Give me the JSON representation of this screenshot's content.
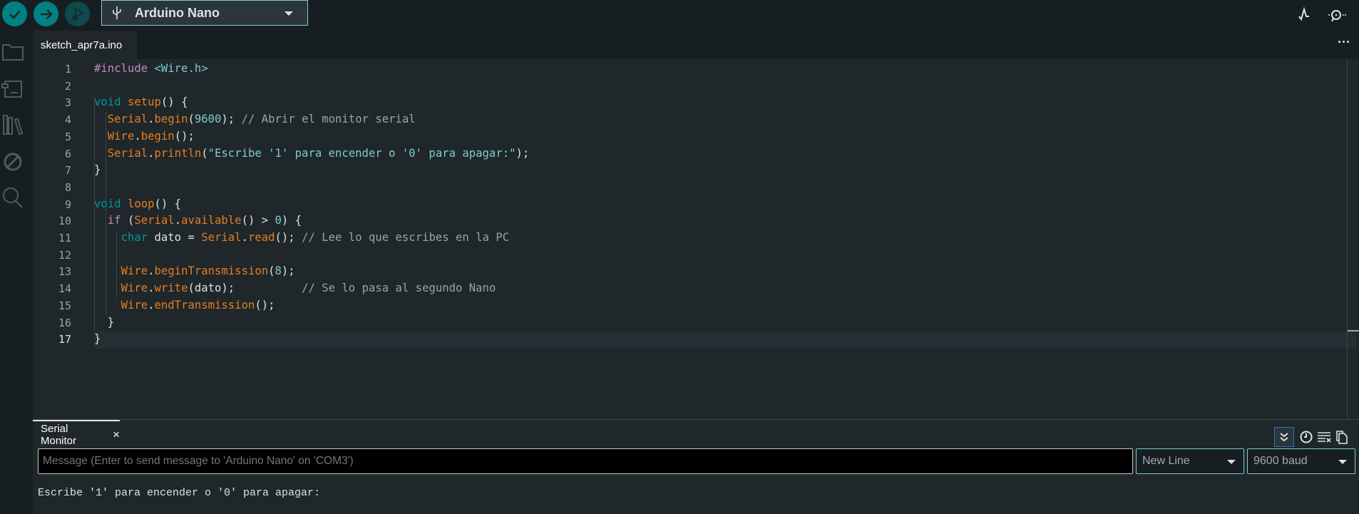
{
  "toolbar": {
    "verify": "check-icon",
    "upload": "arrow-right-icon",
    "debug": "debug-icon",
    "board": "Arduino Nano",
    "serial_plotter": "plotter-icon",
    "serial_monitor": "serial-monitor-icon"
  },
  "tab": {
    "name": "sketch_apr7a.ino",
    "more": "···"
  },
  "editor": {
    "current_line": 17,
    "lines": [
      [
        [
          "#include ",
          "p"
        ],
        [
          "<Wire.h>",
          "s"
        ]
      ],
      [],
      [
        [
          "void ",
          "k"
        ],
        [
          "setup",
          "f"
        ],
        [
          "() {",
          ""
        ]
      ],
      [
        [
          "  ",
          ""
        ],
        [
          "Serial",
          "f"
        ],
        [
          ".",
          ""
        ],
        [
          "begin",
          "f"
        ],
        [
          "(",
          ""
        ],
        [
          "9600",
          "s"
        ],
        [
          "); ",
          ""
        ],
        [
          "// Abrir el monitor serial",
          "c"
        ]
      ],
      [
        [
          "  ",
          ""
        ],
        [
          "Wire",
          "f"
        ],
        [
          ".",
          ""
        ],
        [
          "begin",
          "f"
        ],
        [
          "();",
          ""
        ]
      ],
      [
        [
          "  ",
          ""
        ],
        [
          "Serial",
          "f"
        ],
        [
          ".",
          ""
        ],
        [
          "println",
          "f"
        ],
        [
          "(",
          ""
        ],
        [
          "\"Escribe '1' para encender o '0' para apagar:\"",
          "s"
        ],
        [
          ");",
          ""
        ]
      ],
      [
        [
          "}",
          ""
        ]
      ],
      [],
      [
        [
          "void ",
          "k"
        ],
        [
          "loop",
          "f"
        ],
        [
          "() {",
          ""
        ]
      ],
      [
        [
          "  ",
          ""
        ],
        [
          "if",
          "p"
        ],
        [
          " (",
          ""
        ],
        [
          "Serial",
          "f"
        ],
        [
          ".",
          ""
        ],
        [
          "available",
          "f"
        ],
        [
          "() > ",
          ""
        ],
        [
          "0",
          "s"
        ],
        [
          ") {",
          ""
        ]
      ],
      [
        [
          "    ",
          ""
        ],
        [
          "char",
          "k"
        ],
        [
          " dato = ",
          ""
        ],
        [
          "Serial",
          "f"
        ],
        [
          ".",
          ""
        ],
        [
          "read",
          "f"
        ],
        [
          "(); ",
          ""
        ],
        [
          "// Lee lo que escribes en la PC",
          "c"
        ]
      ],
      [],
      [
        [
          "    ",
          ""
        ],
        [
          "Wire",
          "f"
        ],
        [
          ".",
          ""
        ],
        [
          "beginTransmission",
          "f"
        ],
        [
          "(",
          ""
        ],
        [
          "8",
          "s"
        ],
        [
          ");",
          ""
        ]
      ],
      [
        [
          "    ",
          ""
        ],
        [
          "Wire",
          "f"
        ],
        [
          ".",
          ""
        ],
        [
          "write",
          "f"
        ],
        [
          "(dato);          ",
          ""
        ],
        [
          "// Se lo pasa al segundo Nano",
          "c"
        ]
      ],
      [
        [
          "    ",
          ""
        ],
        [
          "Wire",
          "f"
        ],
        [
          ".",
          ""
        ],
        [
          "endTransmission",
          "f"
        ],
        [
          "();",
          ""
        ]
      ],
      [
        [
          "  }",
          ""
        ]
      ],
      [
        [
          "}",
          ""
        ]
      ]
    ]
  },
  "serial_monitor": {
    "title": "Serial Monitor",
    "close": "×",
    "placeholder": "Message (Enter to send message to 'Arduino Nano' on 'COM3')",
    "line_ending": "New Line",
    "baud": "9600 baud",
    "output": "Escribe '1' para encender o '0' para apagar:"
  }
}
